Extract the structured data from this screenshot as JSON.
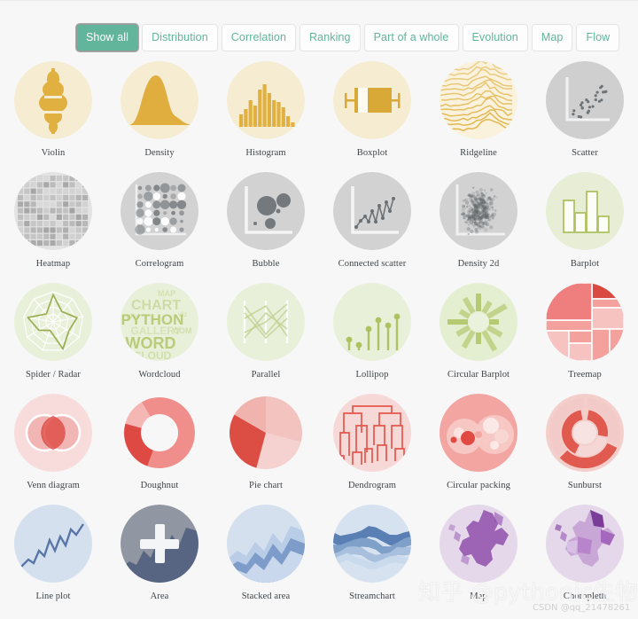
{
  "page": {
    "background_color": "#f7f7f7",
    "accent_color": "#62b49b",
    "label_color": "#3f4448"
  },
  "filter_bar": {
    "tabs": [
      {
        "label": "Show all",
        "active": true
      },
      {
        "label": "Distribution",
        "active": false
      },
      {
        "label": "Correlation",
        "active": false
      },
      {
        "label": "Ranking",
        "active": false
      },
      {
        "label": "Part of a whole",
        "active": false
      },
      {
        "label": "Evolution",
        "active": false
      },
      {
        "label": "Map",
        "active": false
      },
      {
        "label": "Flow",
        "active": false
      }
    ]
  },
  "gallery": {
    "items": [
      {
        "label": "Violin",
        "icon": "violin-icon",
        "family": "distribution",
        "bg": "#f6ecd2",
        "fg": "#e0b040",
        "hover": false
      },
      {
        "label": "Density",
        "icon": "density-icon",
        "family": "distribution",
        "bg": "#f6ecd2",
        "fg": "#dfae3f",
        "hover": false
      },
      {
        "label": "Histogram",
        "icon": "histogram-icon",
        "family": "distribution",
        "bg": "#f6ecd2",
        "fg": "#e0b040",
        "hover": false
      },
      {
        "label": "Boxplot",
        "icon": "boxplot-icon",
        "family": "distribution",
        "bg": "#f6ecd2",
        "fg": "#d9a938",
        "hover": false
      },
      {
        "label": "Ridgeline",
        "icon": "ridgeline-icon",
        "family": "distribution",
        "bg": "#faf2dd",
        "fg": "#e0b040",
        "hover": false
      },
      {
        "label": "Scatter",
        "icon": "scatter-icon",
        "family": "correlation",
        "bg": "#cfcfcf",
        "fg": "#6f7478",
        "hover": false
      },
      {
        "label": "Heatmap",
        "icon": "heatmap-icon",
        "family": "correlation",
        "bg": "#e3e3e3",
        "fg": "#9a9a9a",
        "hover": false
      },
      {
        "label": "Correlogram",
        "icon": "correlogram-icon",
        "family": "correlation",
        "bg": "#d2d2d2",
        "fg": "#6f7478",
        "hover": false
      },
      {
        "label": "Bubble",
        "icon": "bubble-icon",
        "family": "correlation",
        "bg": "#d2d2d2",
        "fg": "#74797d",
        "hover": false
      },
      {
        "label": "Connected scatter",
        "icon": "connected-scatter-icon",
        "family": "correlation",
        "bg": "#d2d2d2",
        "fg": "#6b7074",
        "hover": false
      },
      {
        "label": "Density 2d",
        "icon": "density-2d-icon",
        "family": "correlation",
        "bg": "#d2d2d2",
        "fg": "#5e6367",
        "hover": false
      },
      {
        "label": "Barplot",
        "icon": "barplot-icon",
        "family": "ranking",
        "bg": "#e7eed5",
        "fg": "#aec262",
        "hover": false
      },
      {
        "label": "Spider / Radar",
        "icon": "spider-radar-icon",
        "family": "ranking",
        "bg": "#e9f0da",
        "fg": "#9aae51",
        "hover": false
      },
      {
        "label": "Wordcloud",
        "icon": "wordcloud-icon",
        "family": "ranking",
        "bg": "#e9f0da",
        "fg": "#aec262",
        "hover": false
      },
      {
        "label": "Parallel",
        "icon": "parallel-icon",
        "family": "ranking",
        "bg": "#e9f0da",
        "fg": "#c3d295",
        "hover": false
      },
      {
        "label": "Lollipop",
        "icon": "lollipop-icon",
        "family": "ranking",
        "bg": "#e9f0da",
        "fg": "#aec262",
        "hover": false
      },
      {
        "label": "Circular Barplot",
        "icon": "circular-barplot-icon",
        "family": "ranking",
        "bg": "#e4eed0",
        "fg": "#b4c86e",
        "hover": false
      },
      {
        "label": "Treemap",
        "icon": "treemap-icon",
        "family": "partofwhole",
        "bg": "#ef7f7f",
        "fg": "#ffffff",
        "hover": false
      },
      {
        "label": "Venn diagram",
        "icon": "venn-diagram-icon",
        "family": "partofwhole",
        "bg": "#f7dcdb",
        "fg": "#e98b8b",
        "hover": false
      },
      {
        "label": "Doughnut",
        "icon": "doughnut-icon",
        "family": "partofwhole",
        "bg": "#f7f7f7",
        "fg": "#ef8684",
        "hover": false
      },
      {
        "label": "Pie chart",
        "icon": "pie-chart-icon",
        "family": "partofwhole",
        "bg": "#f7f7f7",
        "fg": "#e15c52",
        "hover": false
      },
      {
        "label": "Dendrogram",
        "icon": "dendrogram-icon",
        "family": "partofwhole",
        "bg": "#f6d9d7",
        "fg": "#e4564c",
        "hover": false
      },
      {
        "label": "Circular packing",
        "icon": "circular-packing-icon",
        "family": "partofwhole",
        "bg": "#f2a5a1",
        "fg": "#e04a42",
        "hover": false
      },
      {
        "label": "Sunburst",
        "icon": "sunburst-icon",
        "family": "partofwhole",
        "bg": "#f4cecb",
        "fg": "#e05a50",
        "hover": false
      },
      {
        "label": "Line plot",
        "icon": "line-plot-icon",
        "family": "evolution",
        "bg": "#d5e0ef",
        "fg": "#5a76a8",
        "hover": false
      },
      {
        "label": "Area",
        "icon": "area-icon",
        "family": "evolution",
        "bg": "#d5e0ef",
        "fg": "#5a76a8",
        "hover": true
      },
      {
        "label": "Stacked area",
        "icon": "stacked-area-icon",
        "family": "evolution",
        "bg": "#d5e0ef",
        "fg": "#5273a6",
        "hover": false
      },
      {
        "label": "Streamchart",
        "icon": "streamchart-icon",
        "family": "evolution",
        "bg": "#d7e2f0",
        "fg": "#4f74aa",
        "hover": false
      },
      {
        "label": "Map",
        "icon": "map-icon",
        "family": "map",
        "bg": "#e4d8ea",
        "fg": "#9150ad",
        "hover": false
      },
      {
        "label": "Choropleth",
        "icon": "choropleth-icon",
        "family": "map",
        "bg": "#e4d8ea",
        "fg": "#9150ad",
        "hover": false
      }
    ],
    "hover_overlay_icon": "plus-icon"
  },
  "watermarks": {
    "zhihu": "知乎 @pythonic生物人",
    "csdn": "CSDN @qq_21478261"
  }
}
